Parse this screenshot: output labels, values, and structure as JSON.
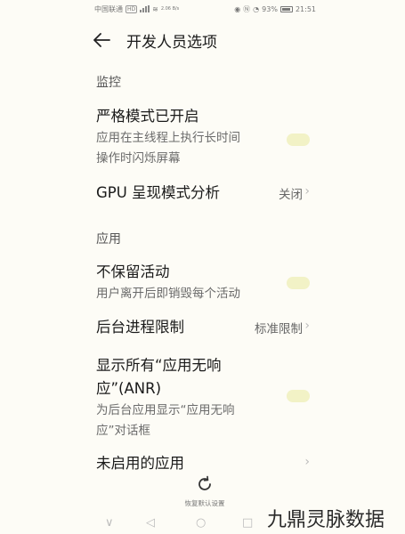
{
  "status": {
    "carrier": "中国联通",
    "hd": "HD",
    "net": "2.06 B/s",
    "battery": "93%",
    "time": "21:51"
  },
  "header": {
    "title": "开发人员选项"
  },
  "sections": [
    {
      "label": "监控"
    },
    {
      "label": "应用"
    }
  ],
  "rows": {
    "strict_mode": {
      "title": "严格模式已开启",
      "sub1": "应用在主线程上执行长时间",
      "sub2": "操作时闪烁屏幕"
    },
    "gpu": {
      "title": "GPU 呈现模式分析",
      "value": "关闭"
    },
    "no_keep": {
      "title": "不保留活动",
      "sub1": "用户离开后即销毁每个活动"
    },
    "bg_limit": {
      "title": "后台进程限制",
      "value": "标准限制"
    },
    "anr": {
      "title1": "显示所有“应用无响",
      "title2": "应”(ANR)",
      "sub1": "为后台应用显示“应用无响",
      "sub2": "应”对话框"
    },
    "inactive": {
      "title": "未启用的应用"
    }
  },
  "reset": {
    "label": "恢复默认设置"
  },
  "watermark": {
    "text": "九鼎灵脉数据"
  },
  "icons": [
    "back-arrow-icon",
    "chevron-right-icon",
    "refresh-icon",
    "nav-back-icon",
    "nav-home-icon",
    "nav-recents-icon"
  ],
  "colors": {
    "background": "#fdfcf6",
    "toggle_off": "#f2f2c6"
  }
}
